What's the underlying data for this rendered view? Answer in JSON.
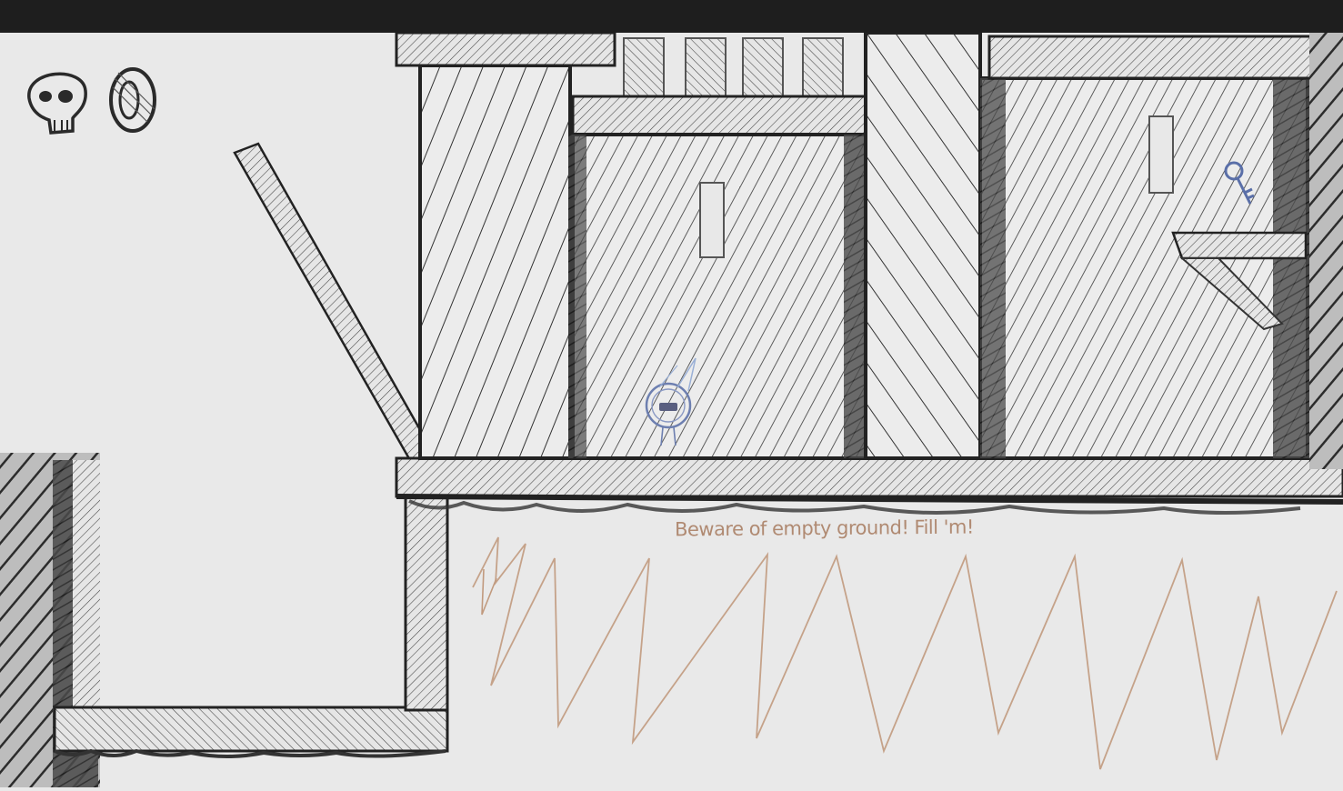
{
  "hud": {
    "deaths_icon": "skull-icon",
    "coin_icon": "coin-icon",
    "coin_count_shown": false
  },
  "hint": {
    "text": "Beware of empty ground! Fill 'm!"
  },
  "pickups": {
    "key_icon": "key-icon"
  },
  "colors": {
    "titlebar": "#1e1e1e",
    "paper": "#e9e9e9",
    "ink": "#2a2a2a",
    "hint_ink": "#b08a72",
    "player_ink": "#6d7fb0",
    "key_ink": "#5a6fa8"
  }
}
